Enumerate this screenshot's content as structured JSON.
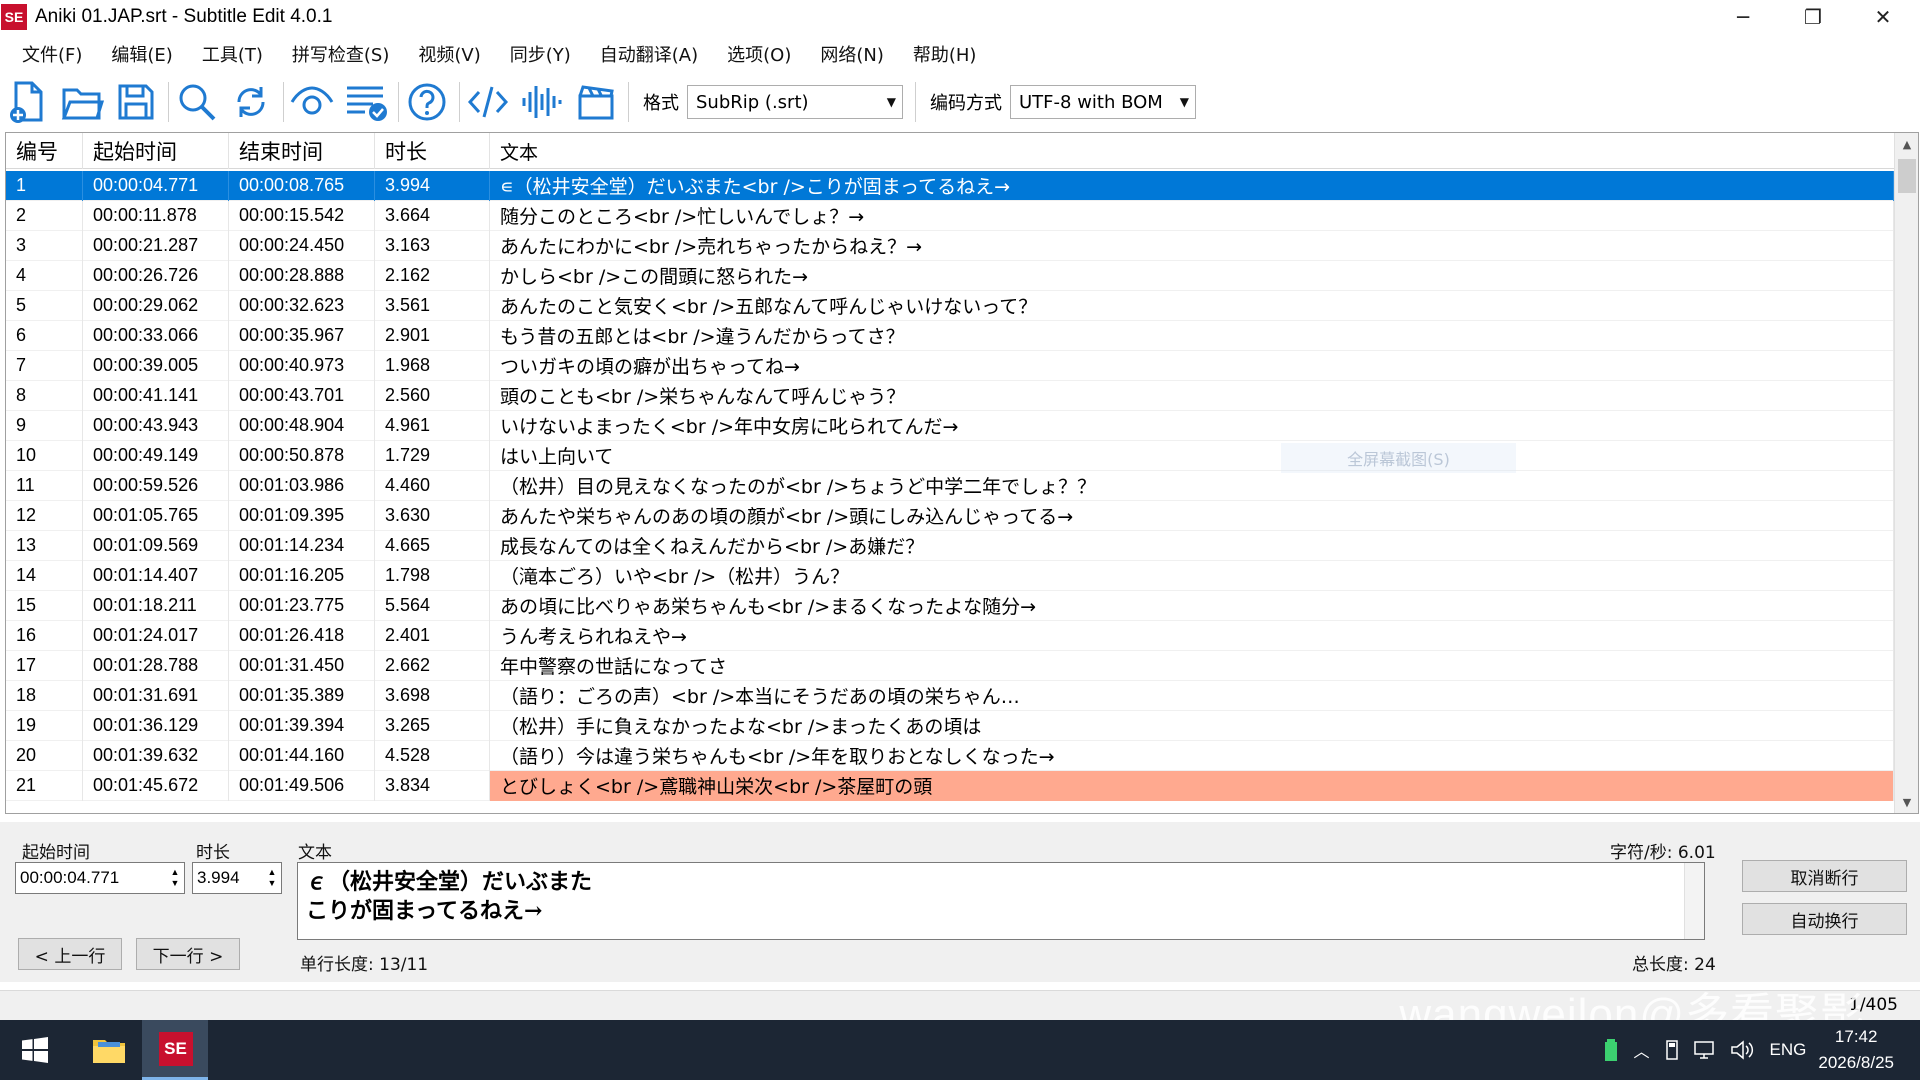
{
  "window": {
    "title": "Aniki 01.JAP.srt - Subtitle Edit 4.0.1",
    "app_icon_text": "SE",
    "controls": {
      "minimize": "─",
      "restore": "❐",
      "close": "✕"
    }
  },
  "menu": [
    "文件(F)",
    "编辑(E)",
    "工具(T)",
    "拼写检查(S)",
    "视频(V)",
    "同步(Y)",
    "自动翻译(A)",
    "选项(O)",
    "网络(N)",
    "帮助(H)"
  ],
  "toolbar": {
    "buttons": [
      "new-file-icon",
      "open-folder-icon",
      "save-icon",
      "search-icon",
      "replace-icon",
      "visual-sync-icon",
      "spell-check-icon",
      "help-icon",
      "source-view-icon",
      "waveform-icon",
      "video-clapper-icon"
    ],
    "format_label": "格式",
    "format_value": "SubRip (.srt)",
    "encoding_label": "编码方式",
    "encoding_value": "UTF-8 with BOM"
  },
  "grid": {
    "columns": [
      "编号",
      "起始时间",
      "结束时间",
      "时长",
      "文本"
    ],
    "rows": [
      {
        "num": "1",
        "start": "00:00:04.771",
        "end": "00:00:08.765",
        "dur": "3.994",
        "text": "∊（松井安全堂）だいぶまた<br />こりが固まってるねえ→",
        "state": "selected"
      },
      {
        "num": "2",
        "start": "00:00:11.878",
        "end": "00:00:15.542",
        "dur": "3.664",
        "text": "随分このところ<br />忙しいんでしょ？→",
        "state": ""
      },
      {
        "num": "3",
        "start": "00:00:21.287",
        "end": "00:00:24.450",
        "dur": "3.163",
        "text": "あんたにわかに<br />売れちゃったからねえ？→",
        "state": ""
      },
      {
        "num": "4",
        "start": "00:00:26.726",
        "end": "00:00:28.888",
        "dur": "2.162",
        "text": "かしら<br />この間頭に怒られた→",
        "state": ""
      },
      {
        "num": "5",
        "start": "00:00:29.062",
        "end": "00:00:32.623",
        "dur": "3.561",
        "text": "あんたのこと気安く<br />五郎なんて呼んじゃいけないって？",
        "state": ""
      },
      {
        "num": "6",
        "start": "00:00:33.066",
        "end": "00:00:35.967",
        "dur": "2.901",
        "text": "もう昔の五郎とは<br />違うんだからってさ？",
        "state": ""
      },
      {
        "num": "7",
        "start": "00:00:39.005",
        "end": "00:00:40.973",
        "dur": "1.968",
        "text": "ついガキの頃の癖が出ちゃってね→",
        "state": ""
      },
      {
        "num": "8",
        "start": "00:00:41.141",
        "end": "00:00:43.701",
        "dur": "2.560",
        "text": "頭のことも<br />栄ちゃんなんて呼んじゃう？",
        "state": ""
      },
      {
        "num": "9",
        "start": "00:00:43.943",
        "end": "00:00:48.904",
        "dur": "4.961",
        "text": "いけないよまったく<br />年中女房に叱られてんだ→",
        "state": ""
      },
      {
        "num": "10",
        "start": "00:00:49.149",
        "end": "00:00:50.878",
        "dur": "1.729",
        "text": "はい上向いて",
        "state": ""
      },
      {
        "num": "11",
        "start": "00:00:59.526",
        "end": "00:01:03.986",
        "dur": "4.460",
        "text": "（松井）目の見えなくなったのが<br />ちょうど中学二年でしょ？？",
        "state": ""
      },
      {
        "num": "12",
        "start": "00:01:05.765",
        "end": "00:01:09.395",
        "dur": "3.630",
        "text": "あんたや栄ちゃんのあの頃の顔が<br />頭にしみ込んじゃってる→",
        "state": ""
      },
      {
        "num": "13",
        "start": "00:01:09.569",
        "end": "00:01:14.234",
        "dur": "4.665",
        "text": "成長なんてのは全くねえんだから<br />あ嫌だ？",
        "state": ""
      },
      {
        "num": "14",
        "start": "00:01:14.407",
        "end": "00:01:16.205",
        "dur": "1.798",
        "text": "（滝本ごろ）いや<br />（松井）うん？",
        "state": ""
      },
      {
        "num": "15",
        "start": "00:01:18.211",
        "end": "00:01:23.775",
        "dur": "5.564",
        "text": "あの頃に比べりゃあ栄ちゃんも<br />まるくなったよな随分→",
        "state": ""
      },
      {
        "num": "16",
        "start": "00:01:24.017",
        "end": "00:01:26.418",
        "dur": "2.401",
        "text": "うん考えられねえや→",
        "state": ""
      },
      {
        "num": "17",
        "start": "00:01:28.788",
        "end": "00:01:31.450",
        "dur": "2.662",
        "text": "年中警察の世話になってさ",
        "state": ""
      },
      {
        "num": "18",
        "start": "00:01:31.691",
        "end": "00:01:35.389",
        "dur": "3.698",
        "text": "（語り：ごろの声）<br />本当にそうだあの頃の栄ちゃん…",
        "state": ""
      },
      {
        "num": "19",
        "start": "00:01:36.129",
        "end": "00:01:39.394",
        "dur": "3.265",
        "text": "（松井）手に負えなかったよな<br />まったくあの頃は",
        "state": ""
      },
      {
        "num": "20",
        "start": "00:01:39.632",
        "end": "00:01:44.160",
        "dur": "4.528",
        "text": "（語り）今は違う栄ちゃんも<br />年を取りおとなしくなった→",
        "state": ""
      },
      {
        "num": "21",
        "start": "00:01:45.672",
        "end": "00:01:49.506",
        "dur": "3.834",
        "text": "とびしょく<br />鳶職神山栄次<br />茶屋町の頭",
        "state": "alert"
      }
    ]
  },
  "editor": {
    "start_label": "起始时间",
    "start_value": "00:00:04.771",
    "duration_label": "时长",
    "duration_value": "3.994",
    "text_label": "文本",
    "text_line1": "∊（松井安全堂）だいぶまた",
    "text_line2": "こりが固まってるねえ→",
    "cps": "字符/秒: 6.01",
    "line_length": "单行长度: 13/11",
    "total_length": "总长度: 24",
    "prev_button": "< 上一行",
    "next_button": "下一行 >",
    "unbreak_button": "取消断行",
    "autobreak_button": "自动换行"
  },
  "status": {
    "position": "1/405"
  },
  "overlay_hint": "全屏幕截图(S)",
  "watermark": "wangweilon@多看聚影",
  "taskbar": {
    "tray_lang": "ENG",
    "time": "17:42",
    "date": "2026/8/25"
  },
  "colors": {
    "selection": "#0078d7",
    "alert_row": "#ffa98f",
    "accent_icon": "#1f7ad1"
  }
}
